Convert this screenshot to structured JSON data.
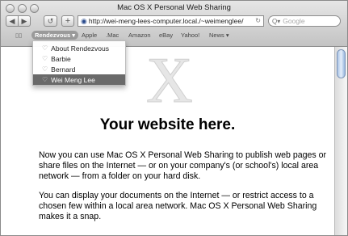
{
  "window": {
    "title": "Mac OS X Personal Web Sharing"
  },
  "toolbar": {
    "back_icon": "◀",
    "forward_icon": "▶",
    "reload_icon": "↺",
    "add_icon": "+",
    "url": "http://wei-meng-lees-computer.local./~weimenglee/",
    "url_reload_icon": "↻",
    "search_placeholder": "Google",
    "search_icon": "Q▾"
  },
  "bookmarks": {
    "book_icon": "▯▯",
    "items": [
      "Rendezvous ▾",
      "Apple",
      ".Mac",
      "Amazon",
      "eBay",
      "Yahoo!",
      "News ▾"
    ]
  },
  "dropdown": {
    "items": [
      {
        "label": "About Rendezvous",
        "selected": false
      },
      {
        "label": "Barbie",
        "selected": false
      },
      {
        "label": "Bernard",
        "selected": false
      },
      {
        "label": "Wei Meng Lee",
        "selected": true
      }
    ]
  },
  "page": {
    "logo": "X",
    "headline": "Your website here.",
    "paragraph1": "Now you can use Mac OS X Personal Web Sharing to publish web pages or share files on the Internet — or on your company's (or school's) local area network — from a folder on your hard disk.",
    "paragraph2": "You can display your documents on the Internet — or restrict access to a chosen few within a local area network. Mac OS X Personal Web Sharing makes it a snap."
  }
}
